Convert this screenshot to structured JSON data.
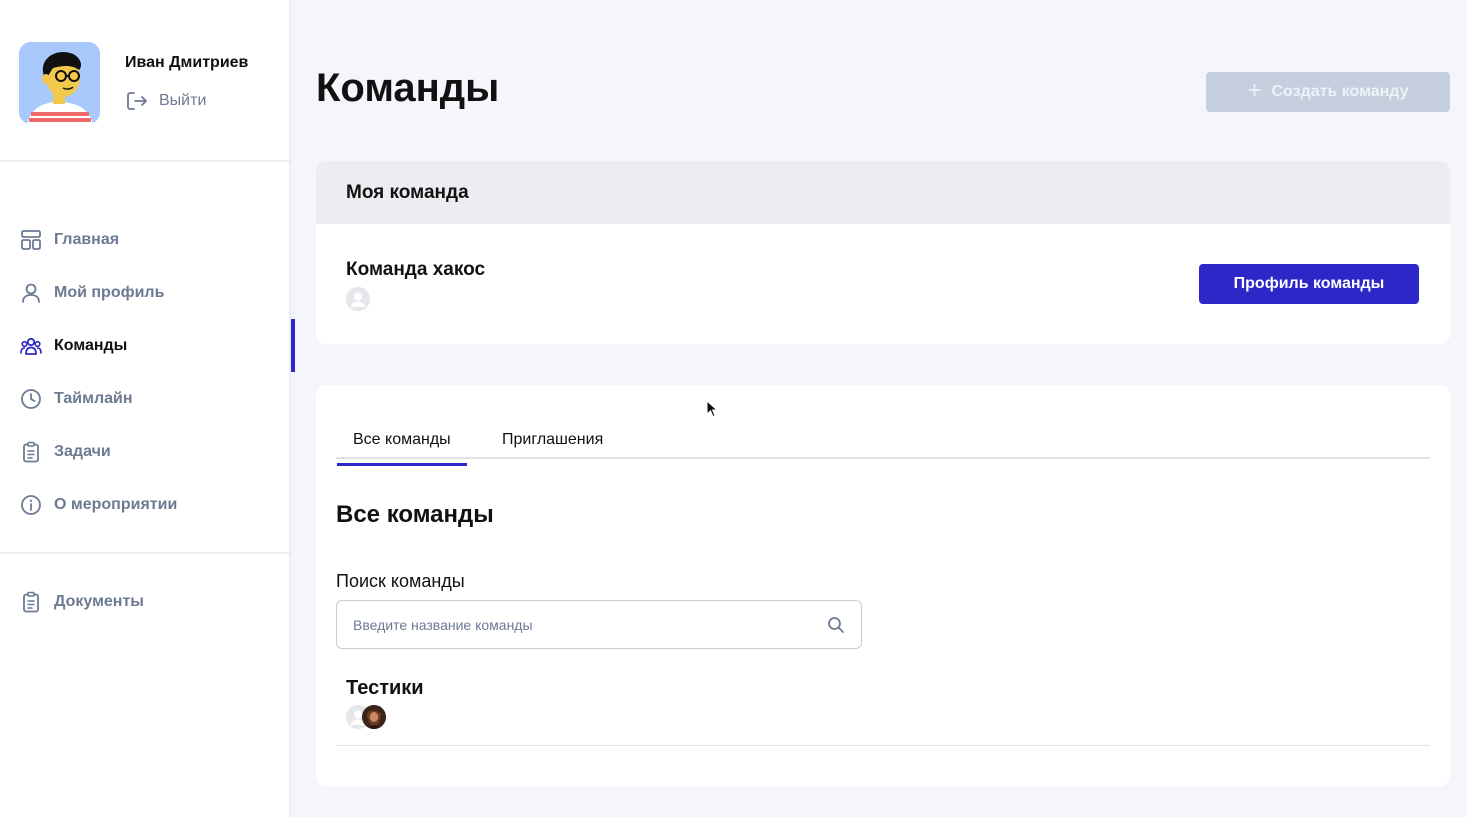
{
  "user": {
    "name": "Иван Дмитриев",
    "logout_label": "Выйти"
  },
  "nav": {
    "items": [
      {
        "label": "Главная",
        "icon": "layout-icon"
      },
      {
        "label": "Мой профиль",
        "icon": "user-icon"
      },
      {
        "label": "Команды",
        "icon": "team-icon",
        "active": true
      },
      {
        "label": "Таймлайн",
        "icon": "clock-icon"
      },
      {
        "label": "Задачи",
        "icon": "clipboard-icon"
      },
      {
        "label": "О мероприятии",
        "icon": "info-icon"
      }
    ],
    "documents_label": "Документы"
  },
  "header": {
    "title": "Команды",
    "create_button_label": "Создать команду"
  },
  "my_team": {
    "header": "Моя команда",
    "team_name": "Команда хакос",
    "profile_button_label": "Профиль команды"
  },
  "all_teams": {
    "tabs": [
      {
        "label": "Все команды",
        "active": true
      },
      {
        "label": "Приглашения",
        "active": false
      }
    ],
    "section_title": "Все команды",
    "search_label": "Поиск команды",
    "search_placeholder": "Введите название команды",
    "teams": [
      {
        "name": "Тестики"
      }
    ]
  },
  "colors": {
    "accent": "#2e27c7",
    "muted_text": "#6c7a93",
    "disabled_button": "#c5cfdd"
  }
}
